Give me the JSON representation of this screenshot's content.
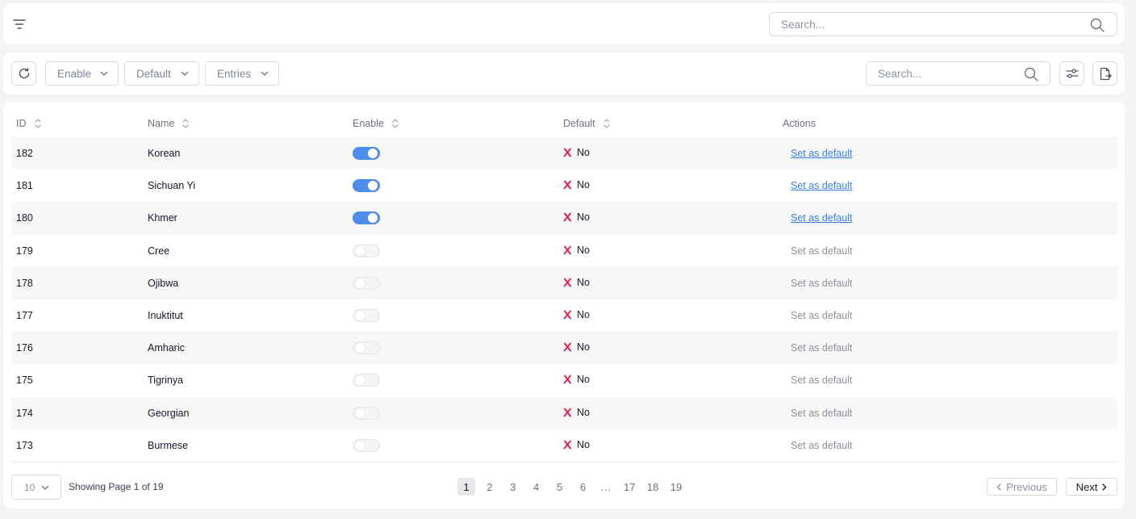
{
  "topbar": {
    "search_placeholder": "Search..."
  },
  "toolbar": {
    "filters": [
      "Enable",
      "Default",
      "Entries"
    ],
    "search_placeholder": "Search..."
  },
  "table": {
    "columns": [
      "ID",
      "Name",
      "Enable",
      "Default",
      "Actions"
    ],
    "rows": [
      {
        "id": "182",
        "name": "Korean",
        "enabled": true,
        "default": "No",
        "action": "Set as default"
      },
      {
        "id": "181",
        "name": "Sichuan Yi",
        "enabled": true,
        "default": "No",
        "action": "Set as default"
      },
      {
        "id": "180",
        "name": "Khmer",
        "enabled": true,
        "default": "No",
        "action": "Set as default"
      },
      {
        "id": "179",
        "name": "Cree",
        "enabled": false,
        "default": "No",
        "action": "Set as default"
      },
      {
        "id": "178",
        "name": "Ojibwa",
        "enabled": false,
        "default": "No",
        "action": "Set as default"
      },
      {
        "id": "177",
        "name": "Inuktitut",
        "enabled": false,
        "default": "No",
        "action": "Set as default"
      },
      {
        "id": "176",
        "name": "Amharic",
        "enabled": false,
        "default": "No",
        "action": "Set as default"
      },
      {
        "id": "175",
        "name": "Tigrinya",
        "enabled": false,
        "default": "No",
        "action": "Set as default"
      },
      {
        "id": "174",
        "name": "Georgian",
        "enabled": false,
        "default": "No",
        "action": "Set as default"
      },
      {
        "id": "173",
        "name": "Burmese",
        "enabled": false,
        "default": "No",
        "action": "Set as default"
      }
    ]
  },
  "pagination": {
    "per_page": "10",
    "showing": "Showing Page 1 of 19",
    "pages": [
      "1",
      "2",
      "3",
      "4",
      "5",
      "6",
      "...",
      "17",
      "18",
      "19"
    ],
    "active_page": "1",
    "previous": "Previous",
    "next": "Next"
  },
  "colors": {
    "toggle_on": "#4f8bea",
    "link": "#3b7de6",
    "no_icon": "#e11d48"
  },
  "icons": [
    "filter-icon",
    "search-icon",
    "refresh-icon",
    "chevron-down-icon",
    "settings-sliders-icon",
    "export-file-icon",
    "sort-icon",
    "x-mark-icon",
    "chevron-left-icon",
    "chevron-right-icon"
  ]
}
